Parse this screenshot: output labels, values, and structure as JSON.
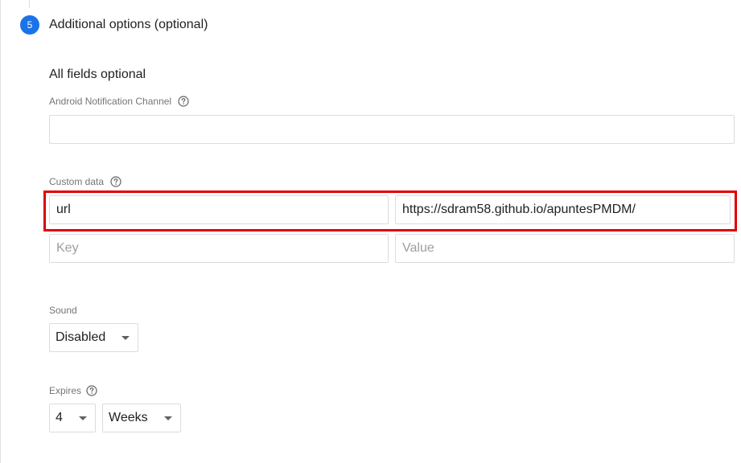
{
  "step": {
    "number": "5",
    "title": "Additional options (optional)"
  },
  "subtitle": "All fields optional",
  "android_channel": {
    "label": "Android Notification Channel",
    "value": ""
  },
  "custom_data": {
    "label": "Custom data",
    "rows": [
      {
        "key": "url",
        "value": "https://sdram58.github.io/apuntesPMDM/"
      }
    ],
    "new_row": {
      "key_placeholder": "Key",
      "value_placeholder": "Value"
    }
  },
  "sound": {
    "label": "Sound",
    "selected": "Disabled"
  },
  "expires": {
    "label": "Expires",
    "amount": "4",
    "unit": "Weeks"
  },
  "colors": {
    "step_badge": "#1a73e8",
    "highlight": "#e00000"
  }
}
